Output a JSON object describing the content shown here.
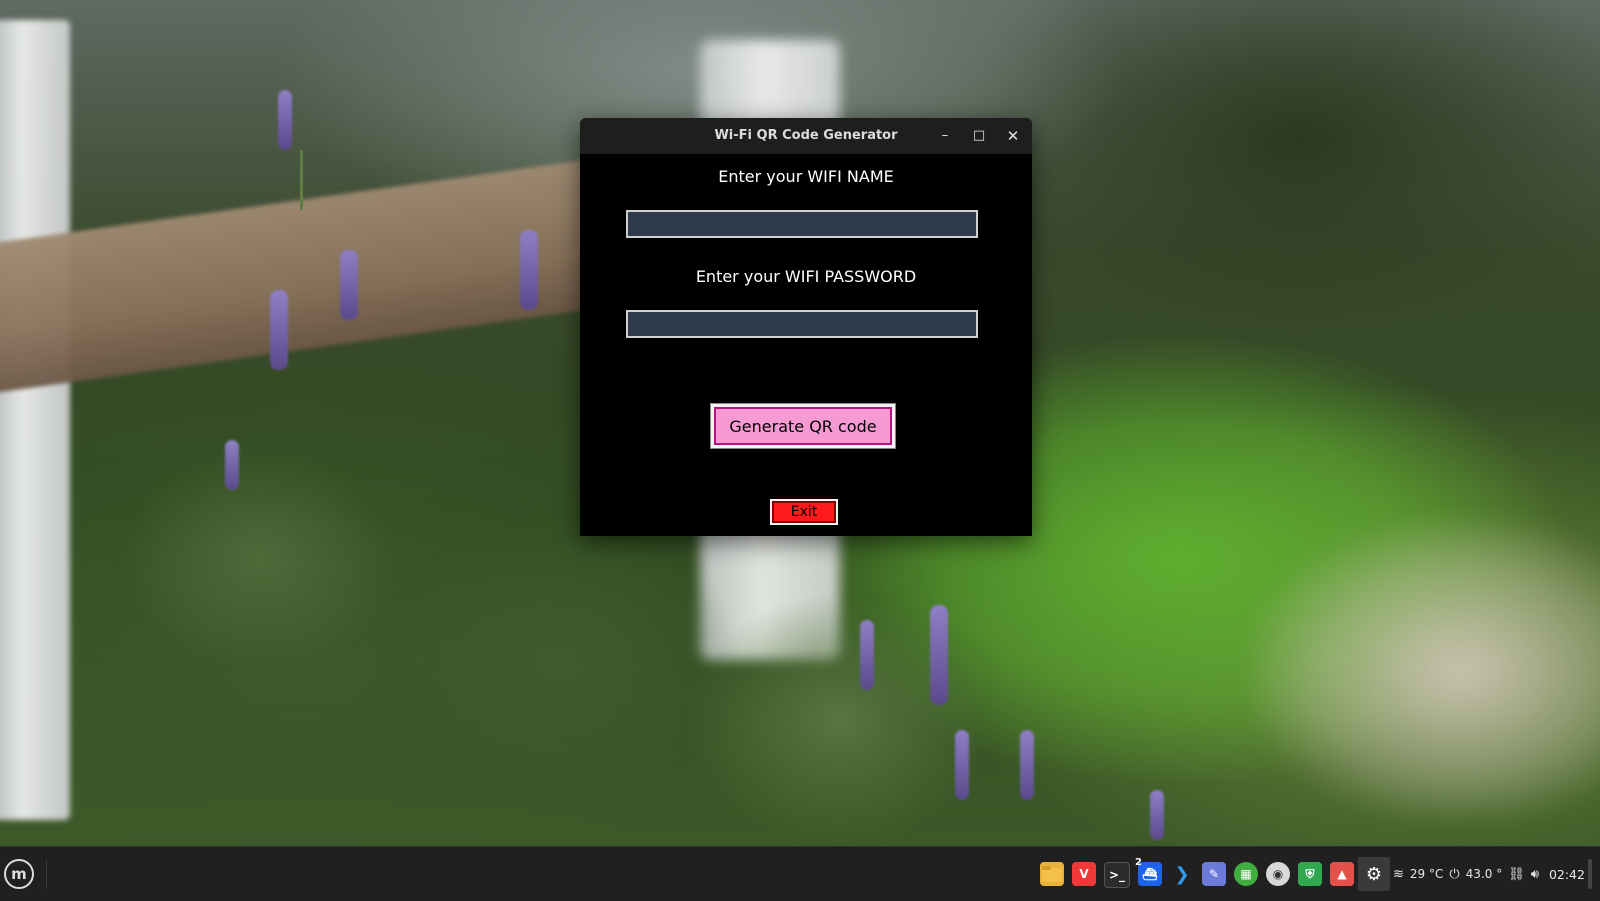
{
  "window": {
    "title": "Wi-Fi QR Code Generator",
    "minimize_glyph": "–",
    "maximize_glyph": "□",
    "close_glyph": "✕"
  },
  "form": {
    "name_label": "Enter your WIFI NAME",
    "name_value": "",
    "password_label": "Enter your WIFI PASSWORD",
    "password_value": "",
    "generate_button": "Generate QR code",
    "exit_button": "Exit"
  },
  "colors": {
    "window_bg": "#000000",
    "entry_bg": "#2f3b4b",
    "generate_bg": "#f59ad3",
    "exit_bg": "#ff1b1b"
  },
  "taskbar": {
    "menu_icon": "linux-mint-menu-icon",
    "apps": [
      {
        "name": "file-manager-icon"
      },
      {
        "name": "vivaldi-browser-icon"
      },
      {
        "name": "terminal-icon"
      },
      {
        "name": "docker-icon",
        "badge": "2"
      },
      {
        "name": "vscode-icon"
      },
      {
        "name": "text-editor-icon"
      },
      {
        "name": "spreadsheet-icon"
      },
      {
        "name": "disk-utility-icon"
      },
      {
        "name": "security-shield-icon"
      },
      {
        "name": "image-viewer-icon"
      },
      {
        "name": "settings-icon"
      }
    ],
    "weather": "29 °C",
    "power_value": "43.0 °",
    "clock": "02:42"
  }
}
